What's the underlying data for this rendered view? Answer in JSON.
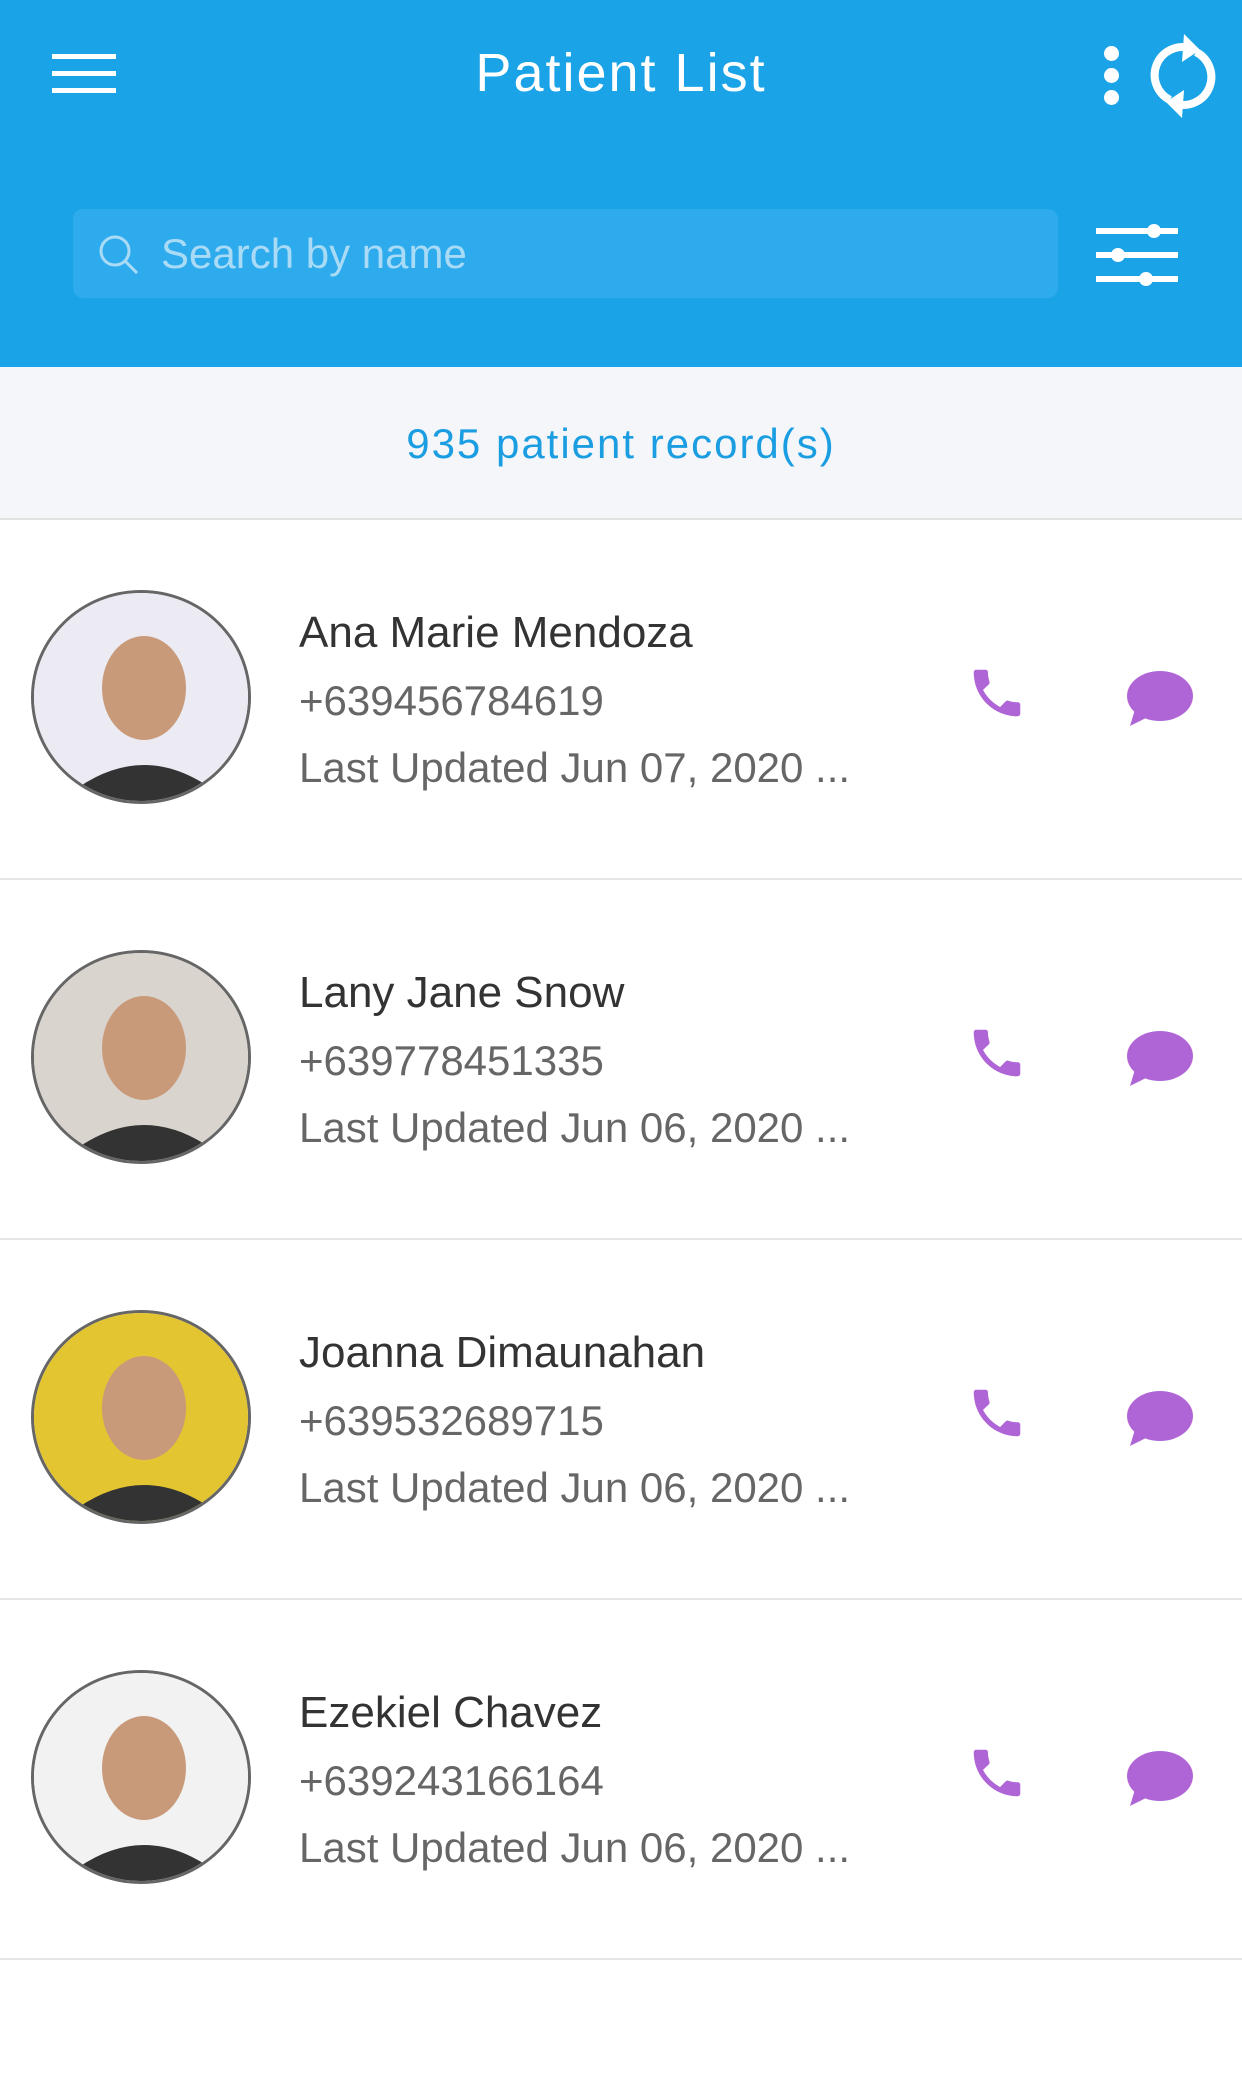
{
  "header": {
    "title": "Patient List",
    "menu_icon": "hamburger-icon",
    "more_icon": "more-vertical-icon",
    "refresh_icon": "refresh-icon",
    "background": "#1ba3e8"
  },
  "search": {
    "placeholder": "Search by name",
    "value": "",
    "filter_icon": "sliders-icon"
  },
  "summary": {
    "count_text": "935 patient record(s)"
  },
  "accent": "#b065d6",
  "patients": [
    {
      "name": "Ana Marie Mendoza",
      "phone": "+639456784619",
      "updated": "Last Updated Jun 07, 2020 ...",
      "avatar_bg": "#ecebf3"
    },
    {
      "name": "Lany Jane Snow",
      "phone": "+639778451335",
      "updated": "Last Updated Jun 06, 2020 ...",
      "avatar_bg": "#d9d4cd"
    },
    {
      "name": "Joanna Dimaunahan",
      "phone": "+639532689715",
      "updated": "Last Updated Jun 06, 2020 ...",
      "avatar_bg": "#e3c431"
    },
    {
      "name": "Ezekiel Chavez",
      "phone": "+639243166164",
      "updated": "Last Updated Jun 06, 2020 ...",
      "avatar_bg": "#f2f2f2"
    }
  ]
}
